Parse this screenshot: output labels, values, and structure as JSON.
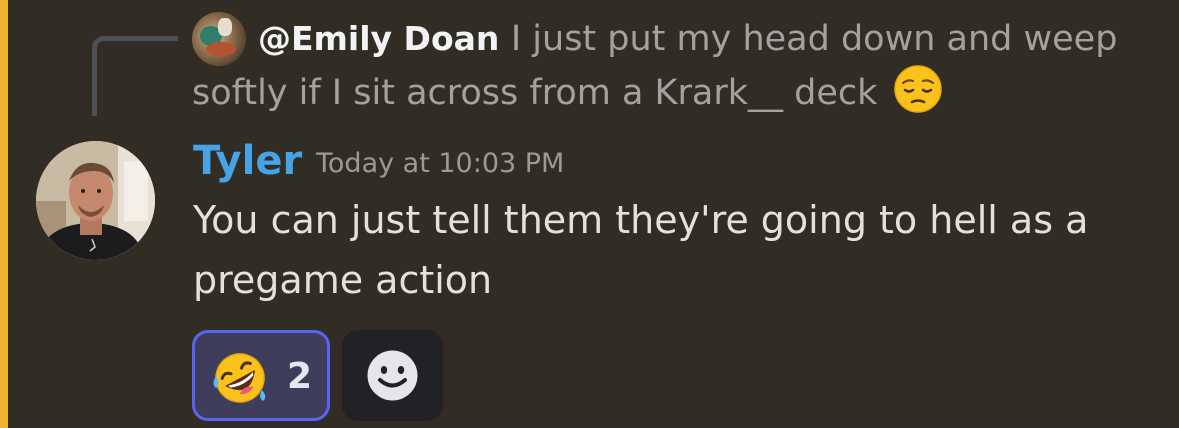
{
  "reply": {
    "author": "@Emily Doan",
    "text_line1": "I just put my head down and weep",
    "text_line2": "softly if I sit across from a Krark__ deck",
    "emoji": "pensive-face-icon"
  },
  "message": {
    "author": "Tyler",
    "timestamp": "Today at 10:03 PM",
    "text": "You can just tell them they're going to hell as a pregame action",
    "author_color": "#46a3e6"
  },
  "reactions": [
    {
      "emoji": "rolling-on-floor-laughing-icon",
      "count": "2",
      "selected": true
    }
  ],
  "add_reaction": {
    "icon": "add-reaction-smiley-icon"
  },
  "colors": {
    "background": "#312c24",
    "accent": "#f0b232",
    "reaction_border": "#5865f2"
  }
}
